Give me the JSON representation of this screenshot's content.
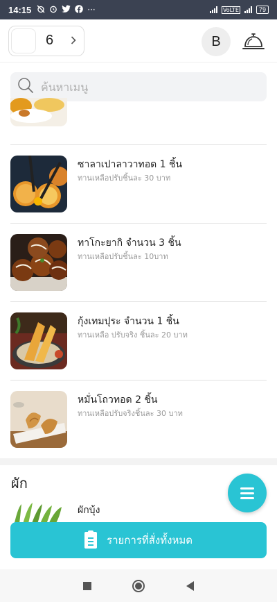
{
  "status_bar": {
    "time": "14:15",
    "left_icons": [
      "alarm-off-icon",
      "alarm-icon",
      "twitter-icon",
      "facebook-icon",
      "more-dots-icon"
    ],
    "more": "···",
    "volte": "VoLTE",
    "battery": "79"
  },
  "header": {
    "table_number": "6",
    "avatar_letter": "B"
  },
  "search": {
    "placeholder": "ค้นหาเมนู"
  },
  "menu_items": [
    {
      "name": "",
      "note": ""
    },
    {
      "name": "ซาลาเปาลาวาทอด 1 ชิ้น",
      "note": "ทานเหลือปรับชิ้นละ 30 บาท"
    },
    {
      "name": "ทาโกะยากิ จำนวน 3 ชิ้น",
      "note": "ทานเหลือปรับชิ้นละ 10บาท"
    },
    {
      "name": "กุ้งเทมปุระ จำนวน 1 ชิ้น",
      "note": "ทานเหลือ ปรับจริง ชิ้นละ 20 บาท"
    },
    {
      "name": "หมั่นโถวทอด 2 ชิ้น",
      "note": "ทานเหลือปรับจริงชิ้นละ 30 บาท"
    }
  ],
  "section": {
    "title": "ผัก",
    "first_item": "ผักบุ้ง"
  },
  "order_bar": {
    "label": "รายการที่สั่งทั้งหมด"
  },
  "colors": {
    "accent": "#29c4d4",
    "status_bar": "#3b4252"
  }
}
